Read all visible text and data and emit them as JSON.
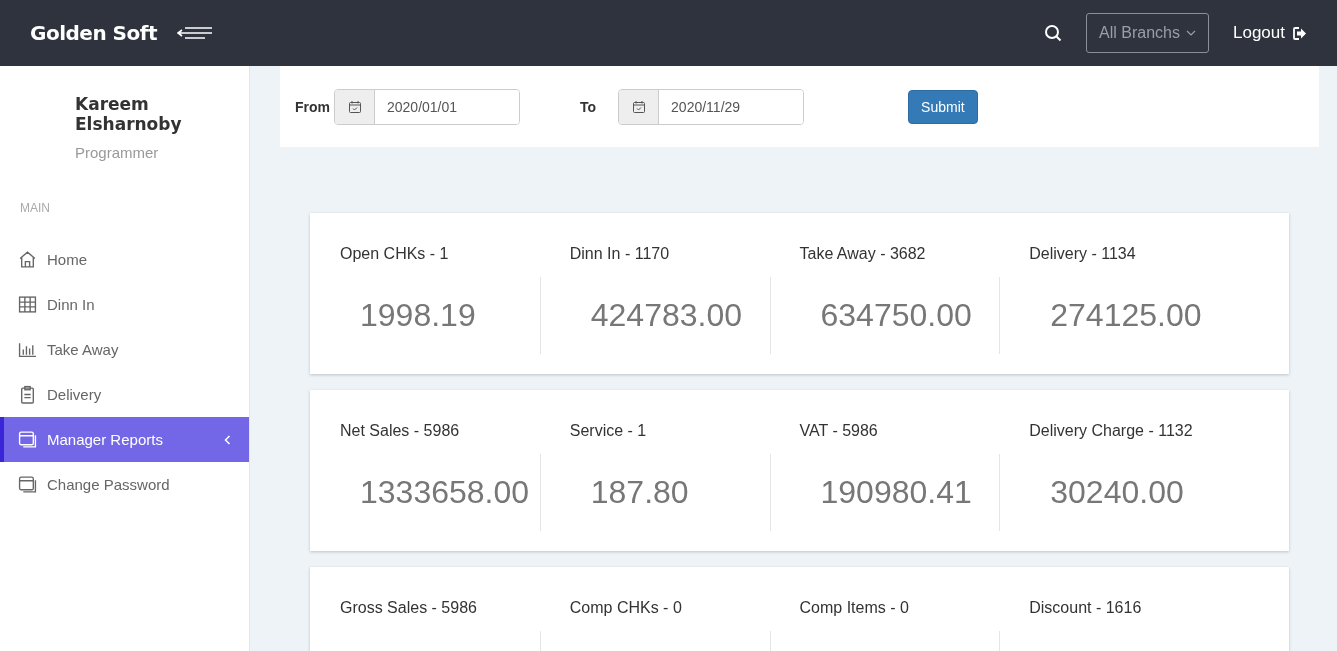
{
  "header": {
    "brand": "Golden Soft",
    "branch_select": {
      "value": "All Branchs"
    },
    "logout": "Logout"
  },
  "user": {
    "name": "Kareem Elsharnoby",
    "role": "Programmer"
  },
  "sidebar": {
    "section": "MAIN",
    "items": [
      {
        "label": "Home",
        "kind": "home",
        "selected": false,
        "has_submenu": false
      },
      {
        "label": "Dinn In",
        "kind": "grid",
        "selected": false,
        "has_submenu": false
      },
      {
        "label": "Take Away",
        "kind": "chart",
        "selected": false,
        "has_submenu": false
      },
      {
        "label": "Delivery",
        "kind": "clipboard",
        "selected": false,
        "has_submenu": false
      },
      {
        "label": "Manager Reports",
        "kind": "window",
        "selected": true,
        "has_submenu": true
      },
      {
        "label": "Change Password",
        "kind": "window",
        "selected": false,
        "has_submenu": false
      }
    ]
  },
  "filter": {
    "from": {
      "label": "From",
      "value": "2020/01/01"
    },
    "to": {
      "label": "To",
      "value": "2020/11/29"
    },
    "submit": "Submit"
  },
  "cards": [
    {
      "stats": [
        {
          "label": "Open CHKs - 1",
          "value": "1998.19"
        },
        {
          "label": "Dinn In - 1170",
          "value": "424783.00"
        },
        {
          "label": "Take Away - 3682",
          "value": "634750.00"
        },
        {
          "label": "Delivery - 1134",
          "value": "274125.00"
        }
      ]
    },
    {
      "stats": [
        {
          "label": "Net Sales - 5986",
          "value": "1333658.00"
        },
        {
          "label": "Service - 1",
          "value": "187.80"
        },
        {
          "label": "VAT - 5986",
          "value": "190980.41"
        },
        {
          "label": "Delivery Charge - 1132",
          "value": "30240.00"
        }
      ]
    },
    {
      "stats": [
        {
          "label": "Gross Sales - 5986"
        },
        {
          "label": "Comp CHKs - 0"
        },
        {
          "label": "Comp Items - 0"
        },
        {
          "label": "Discount - 1616"
        }
      ]
    }
  ]
}
